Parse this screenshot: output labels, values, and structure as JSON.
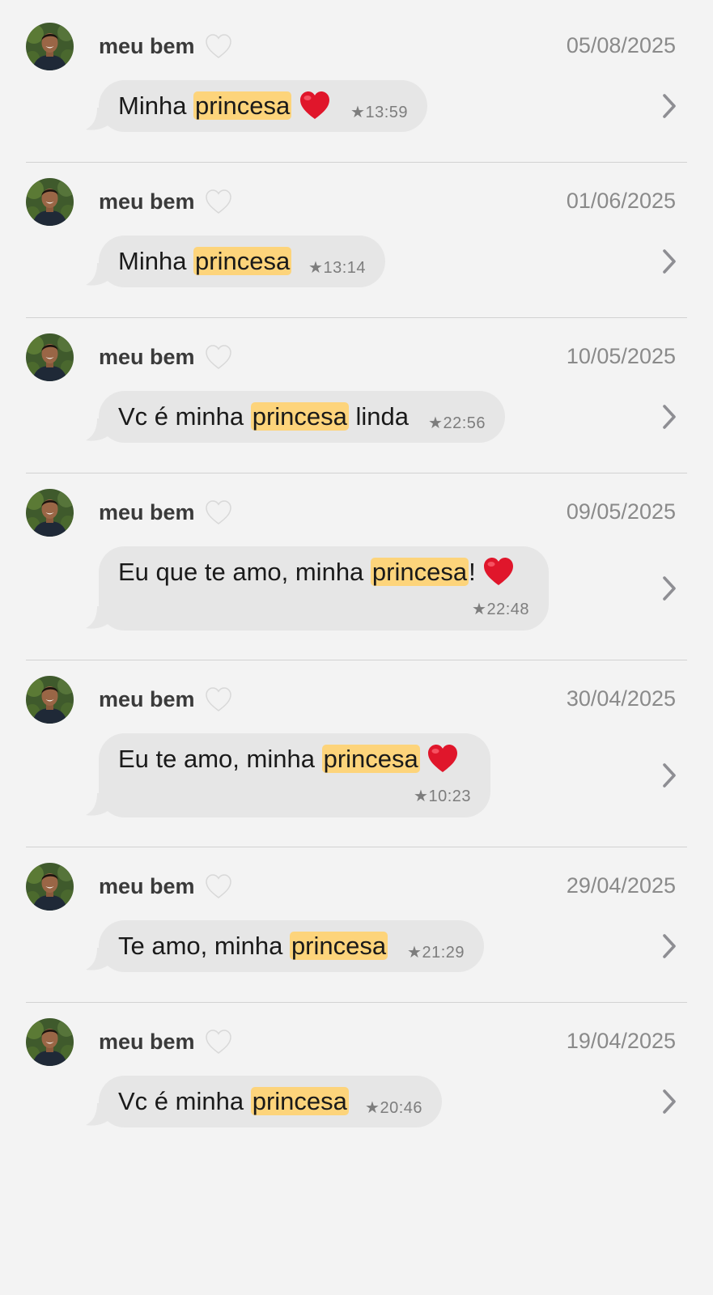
{
  "colors": {
    "background": "#f3f3f3",
    "bubble": "#e6e6e6",
    "highlight": "#fdd47b",
    "sender_text": "#3a3a3a",
    "date_text": "#8a8a8a",
    "meta_text": "#7d7d7d",
    "chevron": "#8e8e93",
    "heart_red": "#e0162b",
    "heart_white": "#f2f2f2"
  },
  "icons": {
    "avatar": "contact-avatar-photo",
    "sender_heart": "white-heart-icon",
    "message_heart": "red-heart-icon",
    "star": "star-icon",
    "disclosure": "chevron-right-icon"
  },
  "results": [
    {
      "sender": "meu bem",
      "date": "05/08/2025",
      "before": "Minha ",
      "match": "princesa",
      "after": "",
      "red_heart": true,
      "time": "★13:59"
    },
    {
      "sender": "meu bem",
      "date": "01/06/2025",
      "before": "Minha ",
      "match": "princesa",
      "after": "",
      "red_heart": false,
      "time": "★13:14"
    },
    {
      "sender": "meu bem",
      "date": "10/05/2025",
      "before": "Vc é minha ",
      "match": "princesa",
      "after": " linda",
      "red_heart": false,
      "time": "★22:56"
    },
    {
      "sender": "meu bem",
      "date": "09/05/2025",
      "before": "Eu que te amo, minha ",
      "match": "princesa",
      "after": "!",
      "red_heart": true,
      "time": "★22:48"
    },
    {
      "sender": "meu bem",
      "date": "30/04/2025",
      "before": "Eu te amo, minha ",
      "match": "princesa",
      "after": "",
      "red_heart": true,
      "time": "★10:23"
    },
    {
      "sender": "meu bem",
      "date": "29/04/2025",
      "before": "Te amo, minha ",
      "match": "princesa",
      "after": "",
      "red_heart": false,
      "time": "★21:29"
    },
    {
      "sender": "meu bem",
      "date": "19/04/2025",
      "before": "Vc é minha ",
      "match": "princesa",
      "after": "",
      "red_heart": false,
      "time": "★20:46"
    }
  ]
}
